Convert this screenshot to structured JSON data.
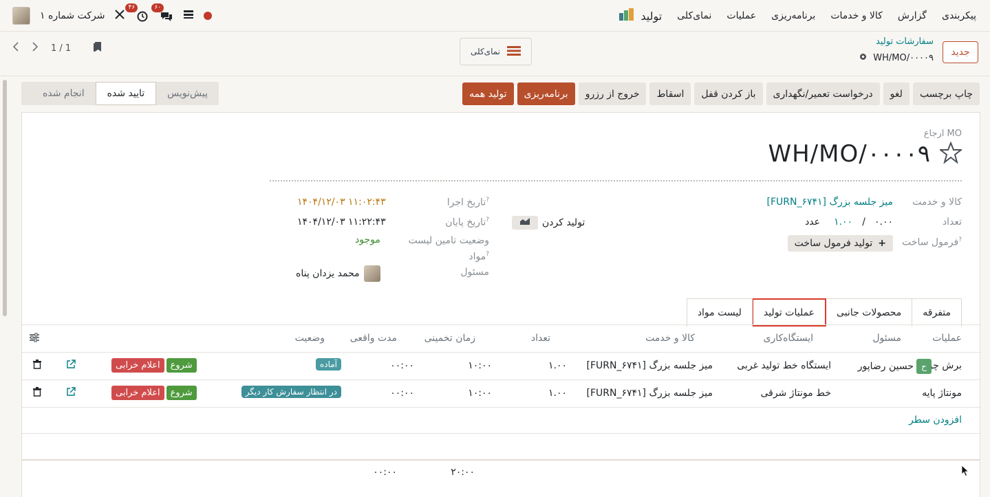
{
  "navbar": {
    "app_name": "تولید",
    "menu": [
      "نمای‌کلی",
      "عملیات",
      "برنامه‌ریزی",
      "کالا و خدمات",
      "گزارش",
      "پیکربندی"
    ],
    "company": "شرکت شماره ۱",
    "activity_badge": "۴۶",
    "messages_badge": "۶۰"
  },
  "control": {
    "new_label": "جدید",
    "breadcrumb_parent": "سفارشات تولید",
    "breadcrumb_current": "WH/MO/۰۰۰۰۹",
    "overview_label": "نمای‌کلی",
    "pager": "1 / 1"
  },
  "actions": [
    "تولید همه",
    "برنامه‌ریزی",
    "خروج از رزرو",
    "اسقاط",
    "باز کردن قفل",
    "درخواست تعمیر/نگهداری",
    "لغو",
    "چاپ برچسب"
  ],
  "statusbar": {
    "draft": "پیش‌نویس",
    "confirmed": "تایید شده",
    "done": "انجام شده"
  },
  "form": {
    "ref_label": "ارجاع MO",
    "ref_value": "WH/MO/۰۰۰۰۹",
    "product_label": "کالا و خدمت",
    "product_value": "[FURN_۶۷۴۱] میز جلسه بزرگ",
    "qty_label": "تعداد",
    "qty_produced": "۰.۰۰",
    "qty_sep": "/",
    "qty_total": "۱.۰۰",
    "qty_uom": "عدد",
    "produce_label": "تولید کردن",
    "bom_label": "فرمول ساخت",
    "bom_button": "تولید فرمول ساخت",
    "date_start_label": "تاریخ اجرا",
    "date_start_value": "۱۴۰۴/۱۲/۰۳ ۱۱:۰۲:۴۳",
    "date_end_label": "تاریخ پایان",
    "date_end_value": "۱۴۰۴/۱۲/۰۳ ۱۱:۲۲:۴۳",
    "components_label_1": "وضعیت تامین لیست",
    "components_label_2": "مواد",
    "components_value": "موجود",
    "responsible_label": "مسئول",
    "responsible_value": "محمد یزدان پناه",
    "help_mark": "?"
  },
  "tabs": [
    "لیست مواد",
    "عملیات تولید",
    "محصولات جانبی",
    "متفرقه"
  ],
  "table": {
    "headers": {
      "operation": "عملیات",
      "responsible": "مسئول",
      "workcenter": "ایستگاه‌کاری",
      "product": "کالا و خدمت",
      "qty": "تعداد",
      "expected": "زمان تخمینی",
      "real": "مدت واقعی",
      "status": "وضعیت"
    },
    "rows": [
      {
        "operation": "برش چوب",
        "responsible_initial": "ح",
        "responsible": "حسین رضاپور",
        "workcenter": "ایستگاه خط تولید غربی",
        "product": "[FURN_۶۷۴۱] میز جلسه بزرگ",
        "qty": "۱.۰۰",
        "expected": "۱۰:۰۰",
        "real": "۰۰:۰۰",
        "status": "آماده",
        "status_color": "#4a9ba3",
        "start": "شروع",
        "block": "اعلام خرابی"
      },
      {
        "operation": "مونتاژ پایه",
        "responsible_initial": "",
        "responsible": "",
        "workcenter": "خط مونتاژ شرقی",
        "product": "[FURN_۶۷۴۱] میز جلسه بزرگ",
        "qty": "۱.۰۰",
        "expected": "۱۰:۰۰",
        "real": "۰۰:۰۰",
        "status": "در انتظار سفارش کار دیگر",
        "status_color": "#3d8f98",
        "start": "شروع",
        "block": "اعلام خرابی"
      }
    ],
    "add_line": "افزودن سطر",
    "total_expected": "۲۰:۰۰",
    "total_real": "۰۰:۰۰"
  },
  "colors": {
    "primary": "#b74e2c",
    "link": "#017e84",
    "start_btn": "#4e9a3d",
    "block_btn": "#d04c4c"
  }
}
